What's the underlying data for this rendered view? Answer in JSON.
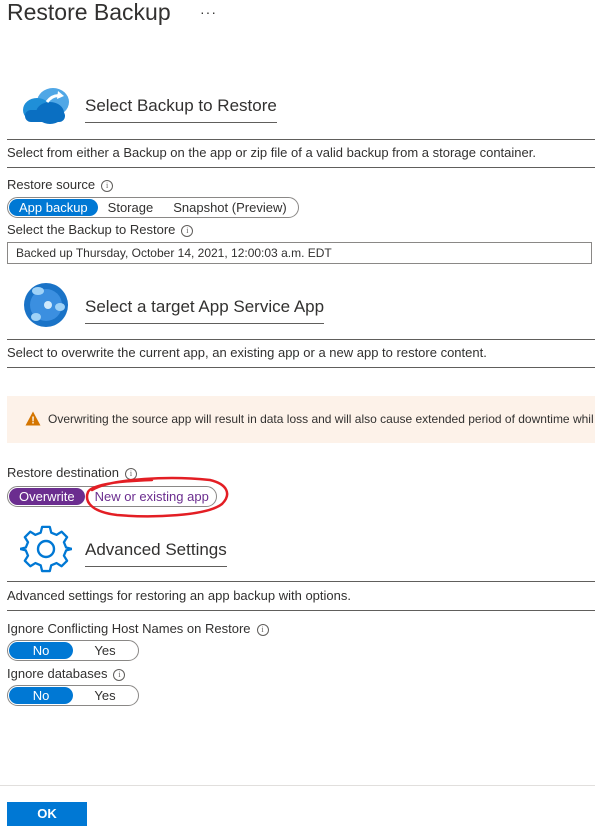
{
  "header": {
    "title": "Restore Backup",
    "more": "···"
  },
  "backup_section": {
    "title": "Select Backup to Restore",
    "description": "Select from either a Backup on the app or zip file of a valid backup from a storage container.",
    "restore_source_label": "Restore source",
    "restore_source_options": [
      "App backup",
      "Storage",
      "Snapshot (Preview)"
    ],
    "select_backup_label": "Select the Backup to Restore",
    "selected_backup": "Backed up Thursday, October 14, 2021, 12:00:03 a.m. EDT"
  },
  "target_section": {
    "title": "Select a target App Service App",
    "description": "Select to overwrite the current app, an existing app or a new app to restore content.",
    "warning": "Overwriting the source app will result in data loss and will also cause extended period of downtime whil",
    "restore_destination_label": "Restore destination",
    "restore_destination_options": [
      "Overwrite",
      "New or existing app"
    ]
  },
  "advanced_section": {
    "title": "Advanced Settings",
    "description": "Advanced settings for restoring an app backup with options.",
    "ignore_hostnames_label": "Ignore Conflicting Host Names on Restore",
    "ignore_hostnames_options": [
      "No",
      "Yes"
    ],
    "ignore_databases_label": "Ignore databases",
    "ignore_databases_options": [
      "No",
      "Yes"
    ]
  },
  "footer": {
    "ok_label": "OK"
  },
  "icons": {
    "info": "i",
    "warning": "!"
  },
  "colors": {
    "accent": "#0078d4",
    "purple": "#6b2d8f",
    "annotation": "#e31e24",
    "warning": "#d47500"
  }
}
